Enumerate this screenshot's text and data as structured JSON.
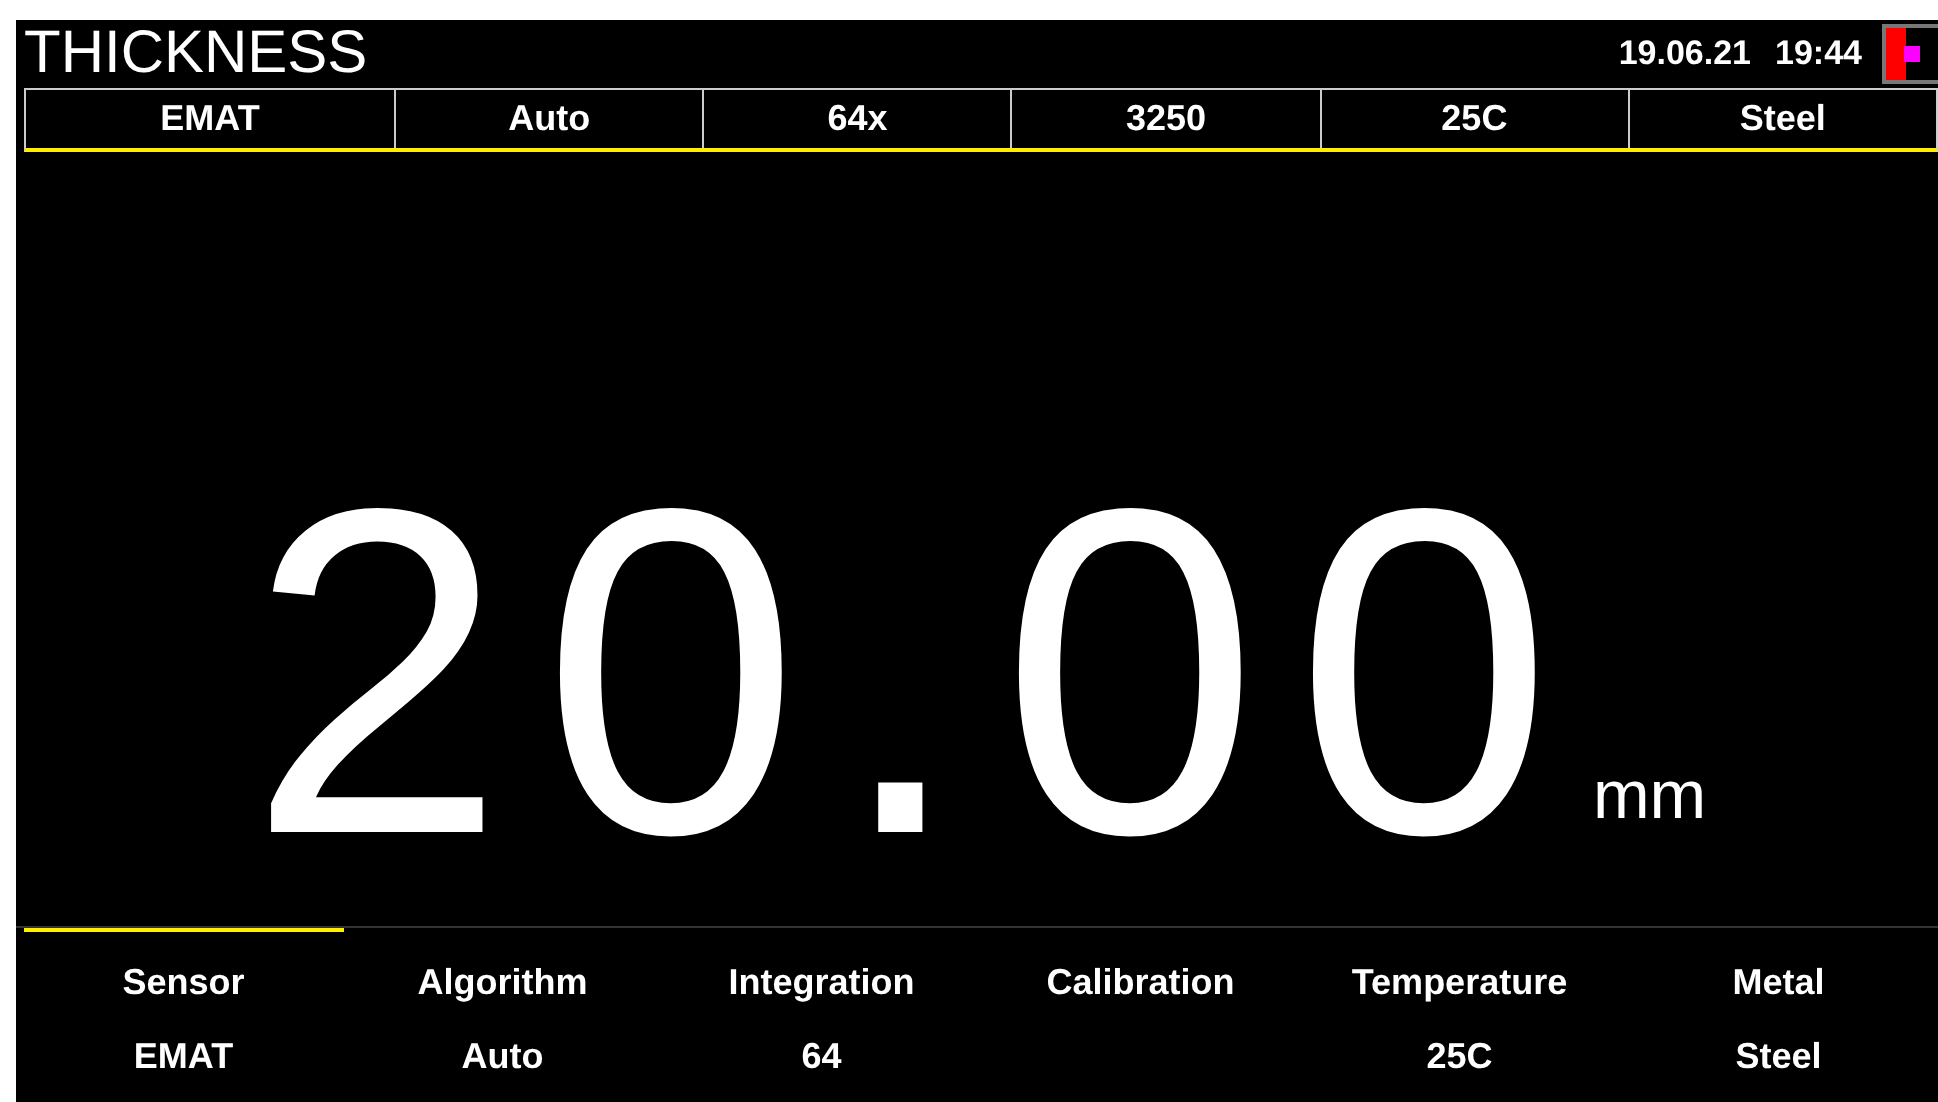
{
  "header": {
    "title": "THICKNESS",
    "date": "19.06.21",
    "time": "19:44"
  },
  "status_bar": [
    "EMAT",
    "Auto",
    "64x",
    "3250",
    "25C",
    "Steel"
  ],
  "reading": {
    "value": "20.00",
    "unit": "mm"
  },
  "tabs": [
    {
      "label": "Sensor",
      "value": "EMAT",
      "selected": true
    },
    {
      "label": "Algorithm",
      "value": "Auto",
      "selected": false
    },
    {
      "label": "Integration",
      "value": "64",
      "selected": false
    },
    {
      "label": "Calibration",
      "selected": false
    },
    {
      "label": "Temperature",
      "value": "25C",
      "selected": false
    },
    {
      "label": "Metal",
      "value": "Steel",
      "selected": false
    }
  ]
}
